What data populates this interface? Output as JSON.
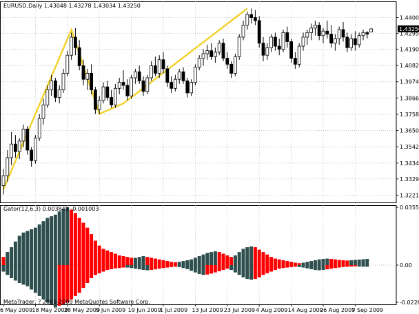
{
  "chart_data": [
    {
      "type": "candlestick",
      "header": {
        "symbol": "EURUSD,Daily",
        "ohlc": [
          "1.43048",
          "1.43278",
          "1.43034",
          "1.43250"
        ]
      },
      "current_price_label": "1.43250",
      "y_range": [
        1.32,
        1.448
      ],
      "y_ticks": [
        "1.44000",
        "1.42950",
        "1.41900",
        "1.40820",
        "1.39740",
        "1.38660",
        "1.37580",
        "1.36500",
        "1.35420",
        "1.34340",
        "1.33290",
        "1.32210"
      ],
      "x_ticks": [
        "6 May 2009",
        "18 May 2009",
        "28 May 2009",
        "9 Jun 2009",
        "19 Jun 2009",
        "1 Jul 2009",
        "13 Jul 2009",
        "23 Jul 2009",
        "4 Aug 2009",
        "14 Aug 2009",
        "26 Aug 2009",
        "7 Sep 2009"
      ],
      "x_tick_bar_index": [
        0,
        8,
        16,
        24,
        32,
        40,
        48,
        56,
        64,
        72,
        80,
        88
      ],
      "ohlc": [
        [
          1.3285,
          1.3395,
          1.3225,
          1.335
        ],
        [
          1.335,
          1.352,
          1.331,
          1.347
        ],
        [
          1.347,
          1.364,
          1.342,
          1.356
        ],
        [
          1.356,
          1.362,
          1.347,
          1.351
        ],
        [
          1.351,
          1.36,
          1.346,
          1.358
        ],
        [
          1.358,
          1.369,
          1.354,
          1.366
        ],
        [
          1.366,
          1.368,
          1.349,
          1.352
        ],
        [
          1.352,
          1.354,
          1.341,
          1.345
        ],
        [
          1.345,
          1.362,
          1.343,
          1.36
        ],
        [
          1.36,
          1.376,
          1.358,
          1.373
        ],
        [
          1.373,
          1.386,
          1.369,
          1.382
        ],
        [
          1.382,
          1.395,
          1.38,
          1.392
        ],
        [
          1.392,
          1.402,
          1.388,
          1.398
        ],
        [
          1.398,
          1.4,
          1.384,
          1.387
        ],
        [
          1.387,
          1.395,
          1.383,
          1.392
        ],
        [
          1.392,
          1.406,
          1.39,
          1.403
        ],
        [
          1.403,
          1.418,
          1.401,
          1.415
        ],
        [
          1.415,
          1.43,
          1.412,
          1.427
        ],
        [
          1.427,
          1.433,
          1.415,
          1.42
        ],
        [
          1.42,
          1.425,
          1.405,
          1.408
        ],
        [
          1.408,
          1.412,
          1.395,
          1.399
        ],
        [
          1.399,
          1.406,
          1.392,
          1.403
        ],
        [
          1.403,
          1.409,
          1.389,
          1.392
        ],
        [
          1.392,
          1.394,
          1.376,
          1.379
        ],
        [
          1.379,
          1.388,
          1.376,
          1.385
        ],
        [
          1.385,
          1.397,
          1.383,
          1.394
        ],
        [
          1.394,
          1.398,
          1.385,
          1.387
        ],
        [
          1.387,
          1.392,
          1.38,
          1.382
        ],
        [
          1.382,
          1.396,
          1.38,
          1.393
        ],
        [
          1.393,
          1.4,
          1.389,
          1.397
        ],
        [
          1.397,
          1.405,
          1.392,
          1.395
        ],
        [
          1.395,
          1.399,
          1.385,
          1.388
        ],
        [
          1.388,
          1.402,
          1.386,
          1.4
        ],
        [
          1.4,
          1.406,
          1.396,
          1.404
        ],
        [
          1.404,
          1.408,
          1.396,
          1.398
        ],
        [
          1.398,
          1.401,
          1.388,
          1.391
        ],
        [
          1.391,
          1.402,
          1.389,
          1.4
        ],
        [
          1.4,
          1.411,
          1.398,
          1.408
        ],
        [
          1.408,
          1.414,
          1.401,
          1.403
        ],
        [
          1.403,
          1.415,
          1.4,
          1.412
        ],
        [
          1.412,
          1.417,
          1.403,
          1.406
        ],
        [
          1.406,
          1.408,
          1.394,
          1.397
        ],
        [
          1.397,
          1.401,
          1.39,
          1.393
        ],
        [
          1.393,
          1.402,
          1.391,
          1.399
        ],
        [
          1.399,
          1.406,
          1.396,
          1.404
        ],
        [
          1.404,
          1.407,
          1.396,
          1.398
        ],
        [
          1.398,
          1.4,
          1.387,
          1.39
        ],
        [
          1.39,
          1.399,
          1.388,
          1.397
        ],
        [
          1.397,
          1.409,
          1.395,
          1.407
        ],
        [
          1.407,
          1.415,
          1.405,
          1.413
        ],
        [
          1.413,
          1.419,
          1.408,
          1.416
        ],
        [
          1.416,
          1.422,
          1.412,
          1.418
        ],
        [
          1.418,
          1.423,
          1.412,
          1.414
        ],
        [
          1.414,
          1.42,
          1.41,
          1.417
        ],
        [
          1.417,
          1.425,
          1.415,
          1.423
        ],
        [
          1.423,
          1.426,
          1.411,
          1.413
        ],
        [
          1.413,
          1.417,
          1.406,
          1.409
        ],
        [
          1.409,
          1.411,
          1.4,
          1.403
        ],
        [
          1.403,
          1.416,
          1.401,
          1.414
        ],
        [
          1.414,
          1.429,
          1.412,
          1.427
        ],
        [
          1.427,
          1.438,
          1.425,
          1.435
        ],
        [
          1.435,
          1.444,
          1.432,
          1.442
        ],
        [
          1.442,
          1.446,
          1.436,
          1.44
        ],
        [
          1.44,
          1.445,
          1.435,
          1.438
        ],
        [
          1.438,
          1.441,
          1.42,
          1.423
        ],
        [
          1.423,
          1.427,
          1.411,
          1.415
        ],
        [
          1.415,
          1.423,
          1.412,
          1.42
        ],
        [
          1.42,
          1.429,
          1.417,
          1.427
        ],
        [
          1.427,
          1.43,
          1.418,
          1.421
        ],
        [
          1.421,
          1.426,
          1.415,
          1.419
        ],
        [
          1.419,
          1.432,
          1.417,
          1.43
        ],
        [
          1.43,
          1.434,
          1.42,
          1.424
        ],
        [
          1.424,
          1.426,
          1.41,
          1.413
        ],
        [
          1.413,
          1.417,
          1.406,
          1.409
        ],
        [
          1.409,
          1.423,
          1.407,
          1.421
        ],
        [
          1.421,
          1.43,
          1.418,
          1.427
        ],
        [
          1.427,
          1.432,
          1.422,
          1.43
        ],
        [
          1.43,
          1.436,
          1.425,
          1.433
        ],
        [
          1.433,
          1.438,
          1.428,
          1.435
        ],
        [
          1.435,
          1.437,
          1.425,
          1.428
        ],
        [
          1.428,
          1.433,
          1.423,
          1.431
        ],
        [
          1.431,
          1.438,
          1.426,
          1.429
        ],
        [
          1.429,
          1.435,
          1.42,
          1.423
        ],
        [
          1.423,
          1.429,
          1.418,
          1.426
        ],
        [
          1.426,
          1.434,
          1.422,
          1.432
        ],
        [
          1.432,
          1.437,
          1.424,
          1.427
        ],
        [
          1.427,
          1.43,
          1.417,
          1.42
        ],
        [
          1.42,
          1.429,
          1.418,
          1.426
        ],
        [
          1.426,
          1.431,
          1.418,
          1.422
        ],
        [
          1.422,
          1.43,
          1.42,
          1.428
        ],
        [
          1.428,
          1.432,
          1.425,
          1.43
        ],
        [
          1.43,
          1.431,
          1.426,
          1.429
        ],
        [
          1.4305,
          1.4328,
          1.4303,
          1.4325
        ]
      ],
      "zigzag": [
        {
          "bar": 0,
          "price": 1.326
        },
        {
          "bar": 17,
          "price": 1.432
        },
        {
          "bar": 24,
          "price": 1.376
        },
        {
          "bar": 30,
          "price": 1.383
        },
        {
          "bar": 61,
          "price": 1.446
        }
      ],
      "colors": {
        "bull_body": "#ffffff",
        "bear_body": "#000000",
        "outline": "#000000",
        "zigzag": "#f2d22e"
      }
    },
    {
      "type": "histogram",
      "header": {
        "name": "Gator(12,6,3)",
        "values": [
          "0.003843",
          "-0.001003"
        ]
      },
      "y_range": [
        -0.02285,
        0.035534
      ],
      "y_ticks": [
        "0.035534",
        "0.00",
        "-0.02285"
      ],
      "series": [
        {
          "values": [
            0.005,
            0.008,
            0.011,
            0.0145,
            0.018,
            0.02,
            0.021,
            0.022,
            0.023,
            0.025,
            0.027,
            0.029,
            0.03,
            0.031,
            0.033,
            0.0345,
            0.0355,
            0.034,
            0.032,
            0.029,
            0.026,
            0.023,
            0.019,
            0.015,
            0.012,
            0.01,
            0.009,
            0.008,
            0.007,
            0.006,
            0.0055,
            0.005,
            0.0045,
            0.0045,
            0.005,
            0.0055,
            0.005,
            0.0045,
            0.004,
            0.0035,
            0.003,
            0.0025,
            0.002,
            0.0018,
            0.002,
            0.0025,
            0.003,
            0.0035,
            0.0045,
            0.0055,
            0.0065,
            0.0075,
            0.008,
            0.0085,
            0.008,
            0.007,
            0.006,
            0.005,
            0.006,
            0.008,
            0.01,
            0.011,
            0.0115,
            0.011,
            0.0095,
            0.008,
            0.0065,
            0.005,
            0.004,
            0.0035,
            0.003,
            0.0025,
            0.002,
            0.0015,
            0.0012,
            0.0015,
            0.002,
            0.0025,
            0.003,
            0.0035,
            0.0038,
            0.004,
            0.0038,
            0.0035,
            0.0032,
            0.003,
            0.0028,
            0.003,
            0.0032,
            0.0034,
            0.0036,
            0.0038
          ],
          "colors": [
            "r",
            "g",
            "g",
            "g",
            "g",
            "g",
            "g",
            "g",
            "g",
            "g",
            "g",
            "g",
            "g",
            "g",
            "g",
            "g",
            "g",
            "r",
            "r",
            "r",
            "r",
            "r",
            "r",
            "r",
            "r",
            "r",
            "r",
            "r",
            "r",
            "r",
            "r",
            "r",
            "r",
            "g",
            "g",
            "g",
            "r",
            "r",
            "r",
            "r",
            "r",
            "r",
            "r",
            "r",
            "g",
            "g",
            "g",
            "g",
            "g",
            "g",
            "g",
            "g",
            "g",
            "g",
            "r",
            "r",
            "r",
            "r",
            "g",
            "g",
            "g",
            "g",
            "g",
            "r",
            "r",
            "r",
            "r",
            "r",
            "r",
            "r",
            "r",
            "r",
            "r",
            "r",
            "r",
            "g",
            "g",
            "g",
            "g",
            "g",
            "g",
            "g",
            "r",
            "r",
            "r",
            "r",
            "r",
            "g",
            "g",
            "g",
            "g",
            "g"
          ]
        },
        {
          "values": [
            -0.004,
            -0.006,
            -0.008,
            -0.0095,
            -0.011,
            -0.012,
            -0.013,
            -0.015,
            -0.017,
            -0.019,
            -0.021,
            -0.023,
            -0.024,
            -0.026,
            -0.025,
            -0.024,
            -0.023,
            -0.021,
            -0.019,
            -0.017,
            -0.014,
            -0.011,
            -0.008,
            -0.006,
            -0.005,
            -0.004,
            -0.003,
            -0.0025,
            -0.002,
            -0.0018,
            -0.0015,
            -0.0015,
            -0.0018,
            -0.0022,
            -0.0026,
            -0.003,
            -0.0032,
            -0.003,
            -0.0026,
            -0.0022,
            -0.0018,
            -0.0015,
            -0.0012,
            -0.001,
            -0.0012,
            -0.0018,
            -0.0025,
            -0.0035,
            -0.0045,
            -0.0055,
            -0.006,
            -0.0058,
            -0.0052,
            -0.0045,
            -0.0038,
            -0.003,
            -0.0022,
            -0.003,
            -0.0045,
            -0.006,
            -0.0075,
            -0.0085,
            -0.009,
            -0.0085,
            -0.0075,
            -0.006,
            -0.005,
            -0.004,
            -0.003,
            -0.0022,
            -0.0018,
            -0.0015,
            -0.0012,
            -0.001,
            -0.0012,
            -0.0015,
            -0.002,
            -0.0025,
            -0.003,
            -0.0032,
            -0.003,
            -0.0026,
            -0.0022,
            -0.0018,
            -0.0015,
            -0.0012,
            -0.001,
            -0.0009,
            -0.0008,
            -0.0009,
            -0.001,
            -0.001
          ],
          "colors": [
            "g",
            "g",
            "g",
            "g",
            "g",
            "g",
            "g",
            "g",
            "g",
            "g",
            "g",
            "g",
            "g",
            "g",
            "r",
            "r",
            "r",
            "r",
            "r",
            "r",
            "r",
            "r",
            "r",
            "r",
            "r",
            "r",
            "r",
            "r",
            "r",
            "r",
            "r",
            "g",
            "g",
            "g",
            "g",
            "g",
            "g",
            "r",
            "r",
            "r",
            "r",
            "r",
            "r",
            "r",
            "g",
            "g",
            "g",
            "g",
            "g",
            "g",
            "g",
            "r",
            "r",
            "r",
            "r",
            "r",
            "r",
            "g",
            "g",
            "g",
            "g",
            "g",
            "g",
            "r",
            "r",
            "r",
            "r",
            "r",
            "r",
            "r",
            "r",
            "r",
            "r",
            "r",
            "g",
            "g",
            "g",
            "g",
            "g",
            "g",
            "g",
            "r",
            "r",
            "r",
            "r",
            "r",
            "r",
            "r",
            "r",
            "g",
            "g",
            "g"
          ]
        }
      ],
      "colors": {
        "g": "#2f4f4f",
        "r": "#ff0000"
      }
    }
  ],
  "copyright": "MetaTrader, ? 2001-2009 MetaQuotes Software Corp."
}
